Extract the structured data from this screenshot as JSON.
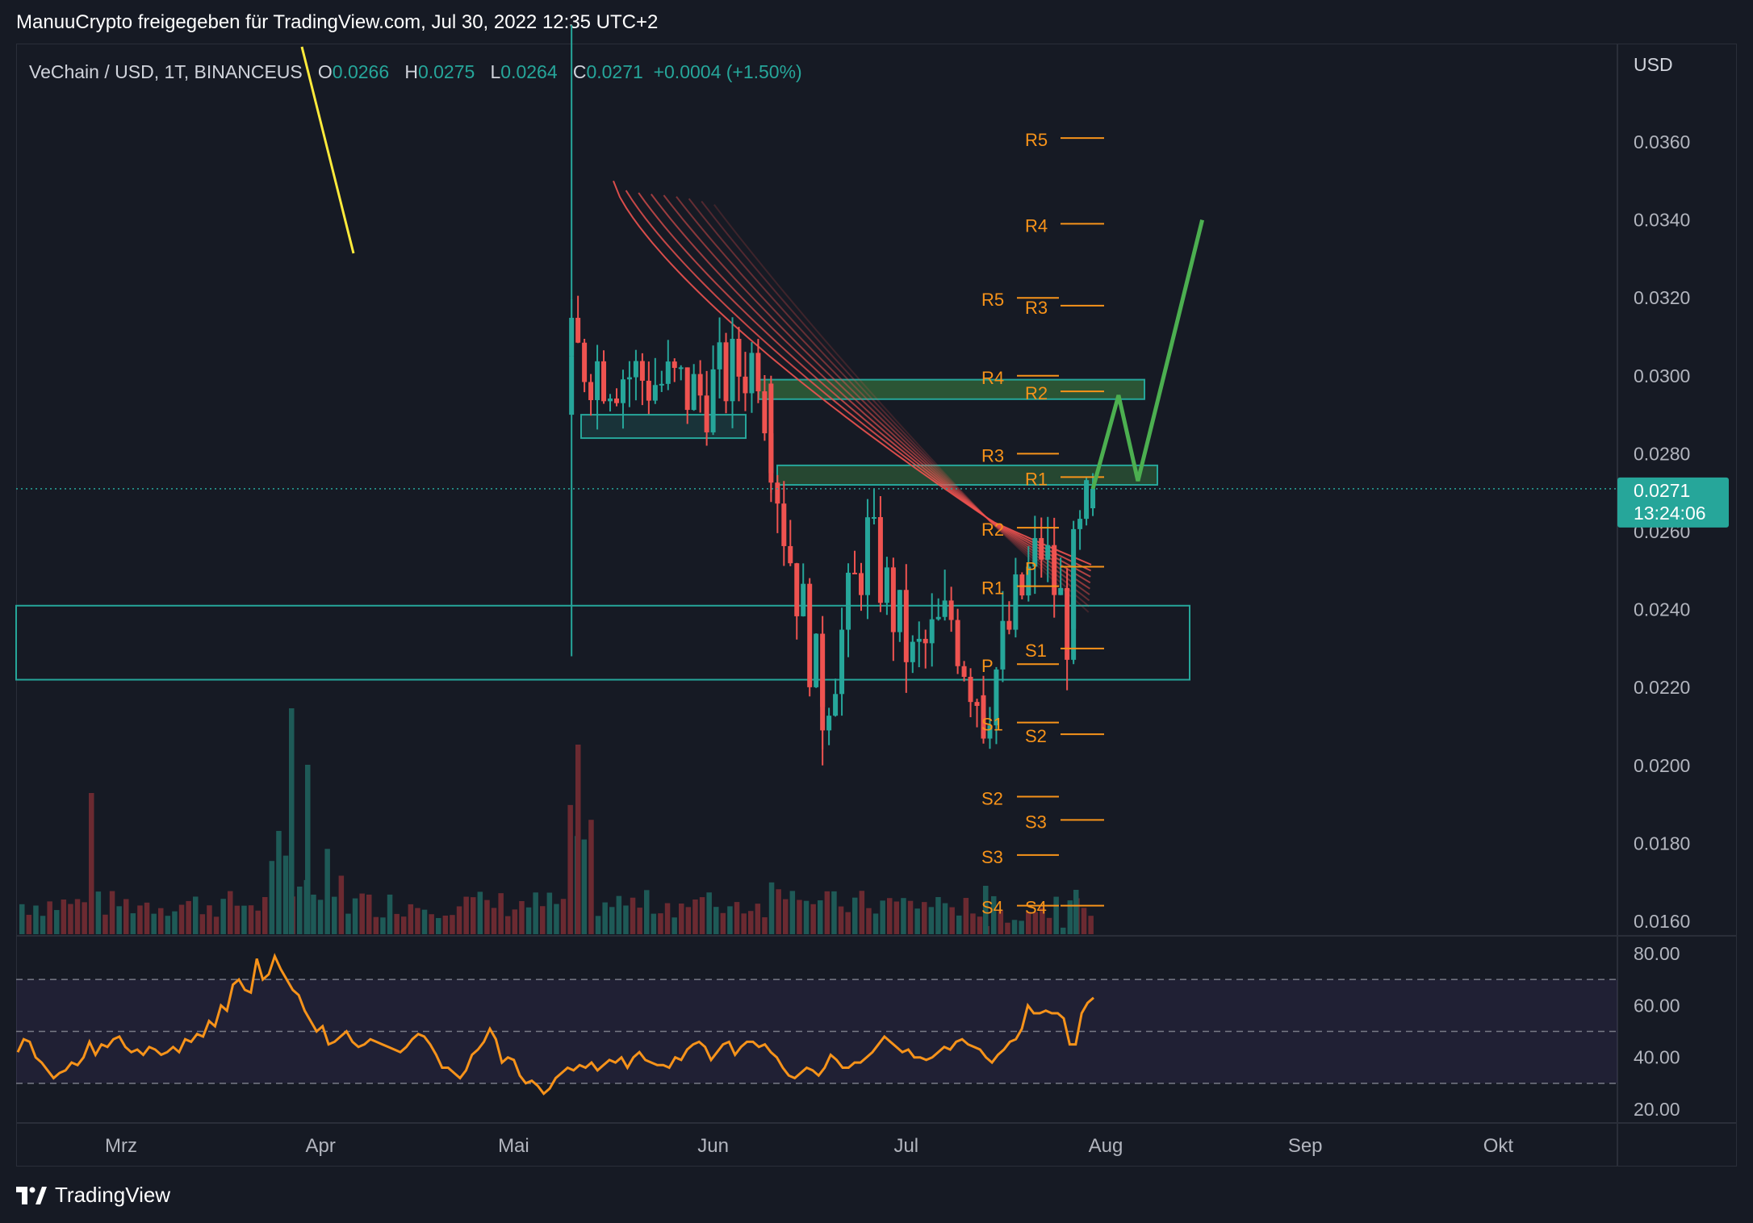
{
  "header": {
    "caption": "ManuuCrypto freigegeben für TradingView.com, Jul 30, 2022 12:35 UTC+2"
  },
  "legend": {
    "symbol": "VeChain / USD, 1T, BINANCEUS",
    "o_label": "O",
    "o": "0.0266",
    "h_label": "H",
    "h": "0.0275",
    "l_label": "L",
    "l": "0.0264",
    "c_label": "C",
    "c": "0.0271",
    "change": "+0.0004 (+1.50%)"
  },
  "footer": {
    "brand": "TradingView"
  },
  "colors": {
    "up": "#26a69a",
    "down": "#ef5350",
    "pivot": "#f7931a",
    "rsi": "#f7931a",
    "zone": "#26a69a",
    "projection": "#4caf50",
    "trendline": "#ffeb3b",
    "background": "#161a24"
  },
  "chart_data": [
    {
      "type": "candlestick",
      "title": "VeChain / USD, 1T, BINANCEUS",
      "currency": "USD",
      "price_axis_ticks": [
        "0.0360",
        "0.0340",
        "0.0320",
        "0.0300",
        "0.0280",
        "0.0260",
        "0.0240",
        "0.0220",
        "0.0200",
        "0.0180",
        "0.0160"
      ],
      "time_axis_ticks": [
        "Mrz",
        "Apr",
        "Mai",
        "Jun",
        "Jul",
        "Aug",
        "Sep",
        "Okt"
      ],
      "ylim": [
        0.016,
        0.038
      ],
      "last_price": "0.0271",
      "countdown": "13:24:06",
      "ohlc_key_candles": [
        {
          "date": "2022-05-10",
          "open": 0.029,
          "high": 0.039,
          "low": 0.0228,
          "close": 0.0305
        },
        {
          "date": "2022-06-10",
          "open": 0.0298,
          "high": 0.03,
          "low": 0.027,
          "close": 0.0275
        },
        {
          "date": "2022-06-18",
          "open": 0.0222,
          "high": 0.0228,
          "low": 0.02,
          "close": 0.0215
        },
        {
          "date": "2022-07-13",
          "open": 0.0218,
          "high": 0.0223,
          "low": 0.0212,
          "close": 0.0214
        },
        {
          "date": "2022-07-27",
          "open": 0.0235,
          "high": 0.0253,
          "low": 0.0226,
          "close": 0.025
        },
        {
          "date": "2022-07-30",
          "open": 0.0266,
          "high": 0.0275,
          "low": 0.0264,
          "close": 0.0271
        }
      ],
      "zones": [
        {
          "name": "support-zone",
          "low": 0.0222,
          "high": 0.0241
        },
        {
          "name": "resistance-zone-1",
          "low": 0.0272,
          "high": 0.0277
        },
        {
          "name": "resistance-zone-2",
          "low": 0.0294,
          "high": 0.0299
        },
        {
          "name": "may-range-zone",
          "low": 0.0284,
          "high": 0.029
        }
      ],
      "pivots_set_a": [
        {
          "label": "R5",
          "value": 0.032
        },
        {
          "label": "R4",
          "value": 0.03
        },
        {
          "label": "R3",
          "value": 0.028
        },
        {
          "label": "R2",
          "value": 0.0261
        },
        {
          "label": "R1",
          "value": 0.0246
        },
        {
          "label": "P",
          "value": 0.0226
        },
        {
          "label": "S1",
          "value": 0.0211
        },
        {
          "label": "S2",
          "value": 0.0192
        },
        {
          "label": "S3",
          "value": 0.0177
        },
        {
          "label": "S4",
          "value": 0.0164
        }
      ],
      "pivots_set_b": [
        {
          "label": "R5",
          "value": 0.0361
        },
        {
          "label": "R4",
          "value": 0.0339
        },
        {
          "label": "R3",
          "value": 0.0318
        },
        {
          "label": "R2",
          "value": 0.0296
        },
        {
          "label": "R1",
          "value": 0.0274
        },
        {
          "label": "P",
          "value": 0.0251
        },
        {
          "label": "S1",
          "value": 0.023
        },
        {
          "label": "S2",
          "value": 0.0208
        },
        {
          "label": "S3",
          "value": 0.0186
        },
        {
          "label": "S4",
          "value": 0.0164
        }
      ],
      "projection_path": [
        {
          "date": "2022-07-30",
          "value": 0.0271
        },
        {
          "date": "2022-08-03",
          "value": 0.0295
        },
        {
          "date": "2022-08-06",
          "value": 0.0273
        },
        {
          "date": "2022-08-16",
          "value": 0.034
        }
      ]
    },
    {
      "type": "line",
      "name": "RSI",
      "ylim": [
        15,
        85
      ],
      "ticks": [
        "80.00",
        "60.00",
        "40.00",
        "20.00"
      ],
      "band": [
        30,
        70
      ],
      "midline": 50,
      "values": [
        42,
        47,
        46,
        40,
        38,
        35,
        32,
        34,
        35,
        38,
        37,
        40,
        46,
        41,
        45,
        44,
        47,
        48,
        44,
        42,
        43,
        41,
        44,
        43,
        41,
        42,
        44,
        42,
        47,
        46,
        49,
        48,
        54,
        52,
        60,
        58,
        68,
        70,
        66,
        65,
        78,
        70,
        72,
        79,
        74,
        70,
        66,
        64,
        58,
        54,
        50,
        52,
        45,
        46,
        48,
        50,
        46,
        44,
        45,
        47,
        46,
        45,
        44,
        43,
        42,
        44,
        47,
        49,
        48,
        45,
        41,
        36,
        36,
        34,
        32,
        35,
        41,
        43,
        46,
        51,
        47,
        38,
        40,
        39,
        33,
        30,
        31,
        29,
        26,
        28,
        32,
        34,
        36,
        35,
        37,
        36,
        38,
        35,
        37,
        39,
        38,
        40,
        36,
        40,
        42,
        39,
        38,
        37,
        37,
        36,
        40,
        39,
        43,
        45,
        46,
        44,
        39,
        42,
        45,
        46,
        41,
        44,
        46,
        46,
        44,
        45,
        42,
        40,
        36,
        33,
        32,
        34,
        36,
        35,
        33,
        36,
        41,
        39,
        36,
        36,
        38,
        38,
        40,
        42,
        45,
        48,
        46,
        44,
        42,
        43,
        40,
        40,
        39,
        40,
        42,
        44,
        43,
        46,
        47,
        45,
        44,
        43,
        40,
        38,
        41,
        43,
        46,
        47,
        51,
        60,
        57,
        57,
        58,
        57,
        57,
        55,
        45,
        45,
        57,
        61,
        63
      ]
    }
  ]
}
